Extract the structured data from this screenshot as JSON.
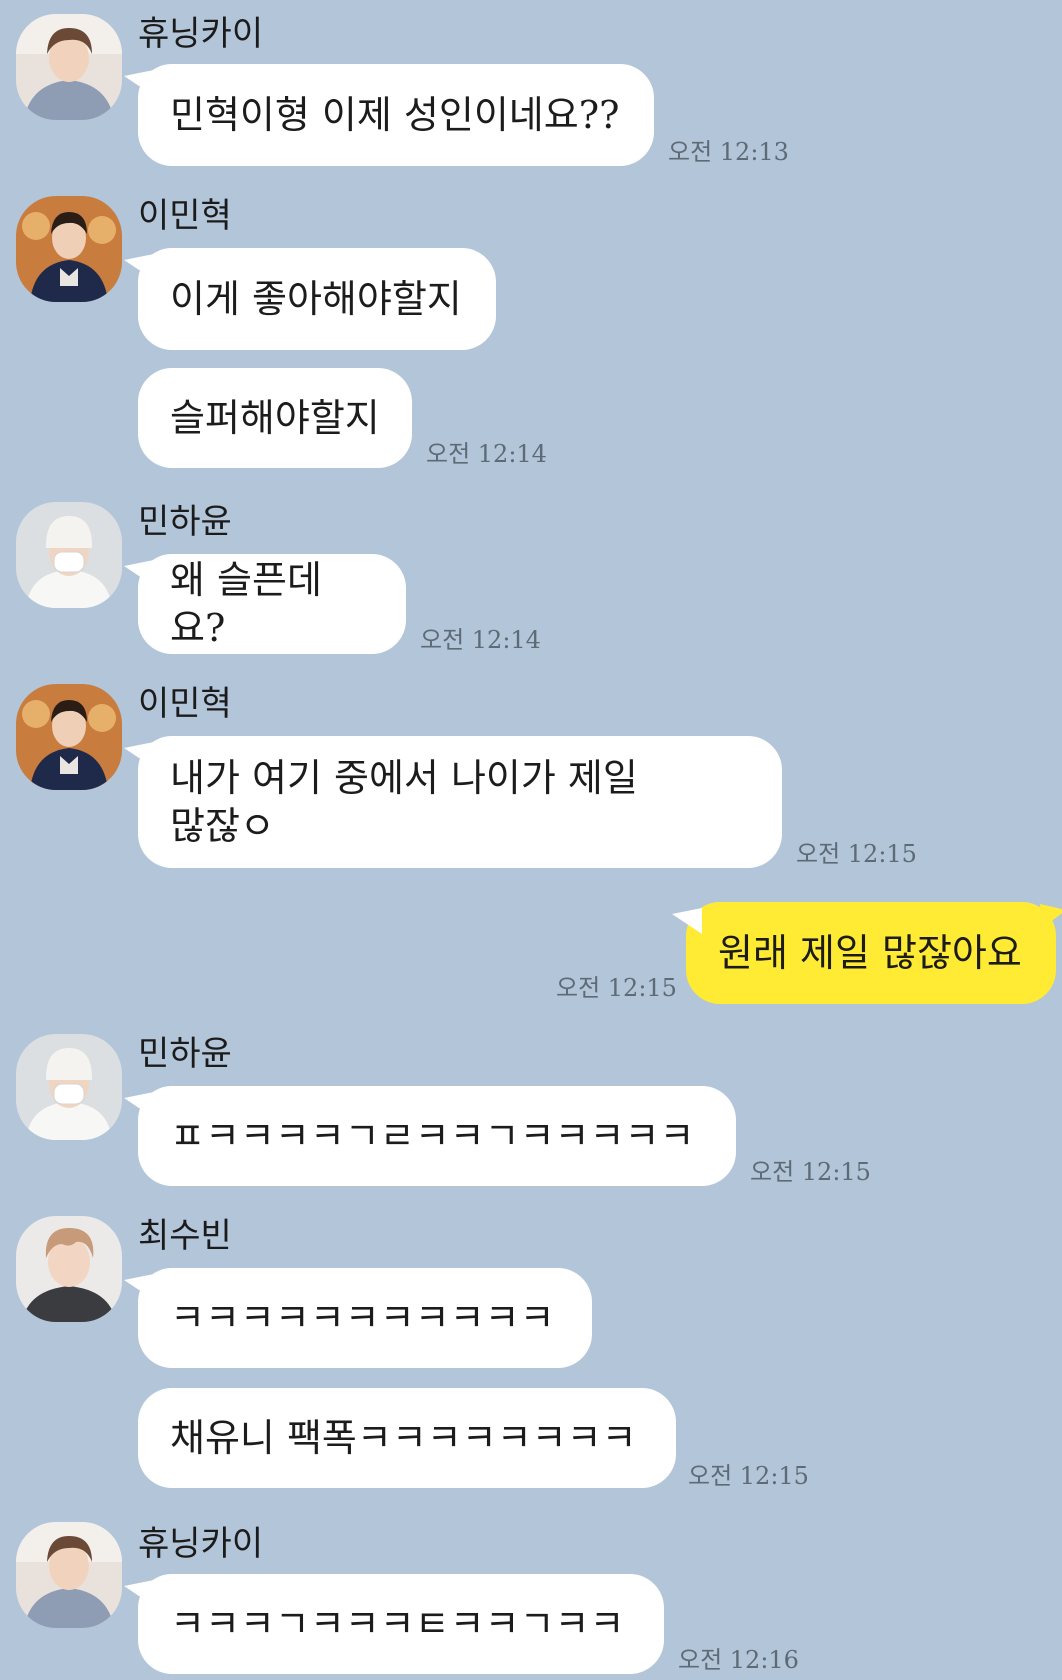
{
  "colors": {
    "background": "#b3c5d8",
    "bubble_other": "#ffffff",
    "bubble_mine": "#ffeb33",
    "time_text": "#5e6a76"
  },
  "messages": [
    {
      "sender": "휴닝카이",
      "avatar_icon": "profile-photo-huening-kai",
      "text": "민혁이형 이제 성인이네요??",
      "time": "오전 12:13"
    },
    {
      "sender": "이민혁",
      "avatar_icon": "profile-photo-lee-minhyuk",
      "text": "이게 좋아해야할지",
      "time": ""
    },
    {
      "sender": "",
      "text": "슬퍼해야할지",
      "time": "오전 12:14"
    },
    {
      "sender": "민하윤",
      "avatar_icon": "profile-photo-min-hayoon",
      "text": "왜 슬픈데요?",
      "time": "오전 12:14"
    },
    {
      "sender": "이민혁",
      "avatar_icon": "profile-photo-lee-minhyuk",
      "text": "내가 여기 중에서 나이가 제일\n많잖ㅇ",
      "time": "오전 12:15"
    },
    {
      "sender": "me",
      "text": "원래 제일 많잖아요",
      "time": "오전 12:15"
    },
    {
      "sender": "민하윤",
      "avatar_icon": "profile-photo-min-hayoon",
      "text": "ㅍㅋㅋㅋㅋㄱㄹㅋㅋㄱㅋㅋㅋㅋㅋ",
      "time": "오전 12:15"
    },
    {
      "sender": "최수빈",
      "avatar_icon": "profile-photo-choi-soobin",
      "text": "ㅋㅋㅋㅋㅋㅋㅋㅋㅋㅋㅋ",
      "time": ""
    },
    {
      "sender": "",
      "text": "채유니 팩폭ㅋㅋㅋㅋㅋㅋㅋㅋ",
      "time": "오전 12:15"
    },
    {
      "sender": "휴닝카이",
      "avatar_icon": "profile-photo-huening-kai",
      "text": "ㅋㅋㅋㄱㅋㅋㅋㅌㅋㅋㄱㅋㅋ",
      "time": "오전 12:16"
    }
  ]
}
